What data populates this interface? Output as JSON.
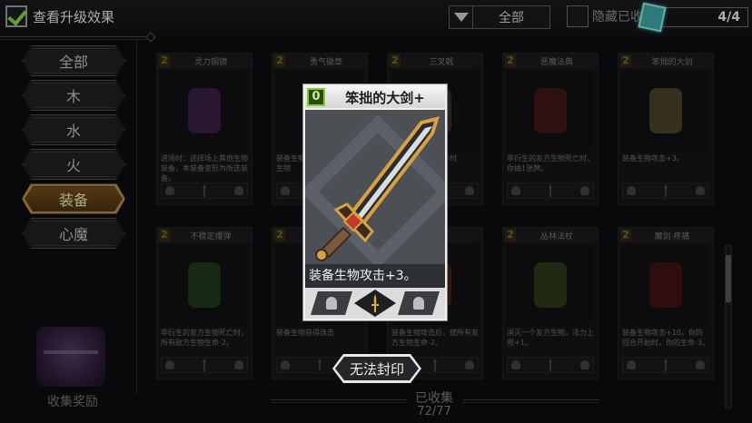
{
  "topbar": {
    "show_upgrade_label": "查看升级效果",
    "filter_value": "全部",
    "hide_label": "隐藏已收",
    "counter": "4/4"
  },
  "tabs": [
    {
      "label": "全部",
      "active": false
    },
    {
      "label": "木",
      "active": false
    },
    {
      "label": "水",
      "active": false
    },
    {
      "label": "火",
      "active": false
    },
    {
      "label": "装备",
      "active": true
    },
    {
      "label": "心魔",
      "active": false
    }
  ],
  "reward": {
    "label": "收集奖励"
  },
  "cards": [
    {
      "cost": "2",
      "name": "灵力铜镜",
      "desc": "进场时：选择场上其他生物装备，本装备变形为所选装备。",
      "color": "#5a2f6e"
    },
    {
      "cost": "2",
      "name": "勇气徽章",
      "desc": "装备生物攻击时，你的友方生物",
      "color": "#7a5a20"
    },
    {
      "cost": "2",
      "name": "三叉戟",
      "desc": "装备生物攻击对手时",
      "color": "#5a4a30"
    },
    {
      "cost": "2",
      "name": "恶魔法典",
      "desc": "非衍生的友方生物死亡时，你抽1张牌。",
      "color": "#6a2020"
    },
    {
      "cost": "2",
      "name": "笨拙的大剑",
      "desc": "装备生物攻击+3。",
      "color": "#7a6a40"
    },
    {
      "cost": "2",
      "name": "不稳定爆弹",
      "desc": "非衍生的友方生物死亡时，所有敌方生物生命-2。",
      "color": "#2e5a24"
    },
    {
      "cost": "2",
      "name": "",
      "desc": "装备生物获得连击",
      "color": "#5a4a30"
    },
    {
      "cost": "2",
      "name": "",
      "desc": "装备生物攻击后，使所有友方生物生命-2。",
      "color": "#6a3010"
    },
    {
      "cost": "2",
      "name": "丛林法杖",
      "desc": "消灭一个友方生物，法力上限+1。",
      "color": "#4a5a20"
    },
    {
      "cost": "2",
      "name": "魔剑·疼痛",
      "desc": "装备生物攻击+10。你的回合开始时，你的生命-3。",
      "color": "#6a1818"
    }
  ],
  "collection": {
    "label": "已收集",
    "count": "72/77"
  },
  "detail": {
    "cost": "0",
    "name": "笨拙的大剑+",
    "description": "装备生物攻击+3。"
  },
  "seal_button": {
    "label": "无法封印"
  },
  "colors": {
    "accent_gold": "#b8893a",
    "check_green": "#7fd24a",
    "cost_green": "#7ccf2f",
    "gem_teal": "#3aa6a0"
  }
}
